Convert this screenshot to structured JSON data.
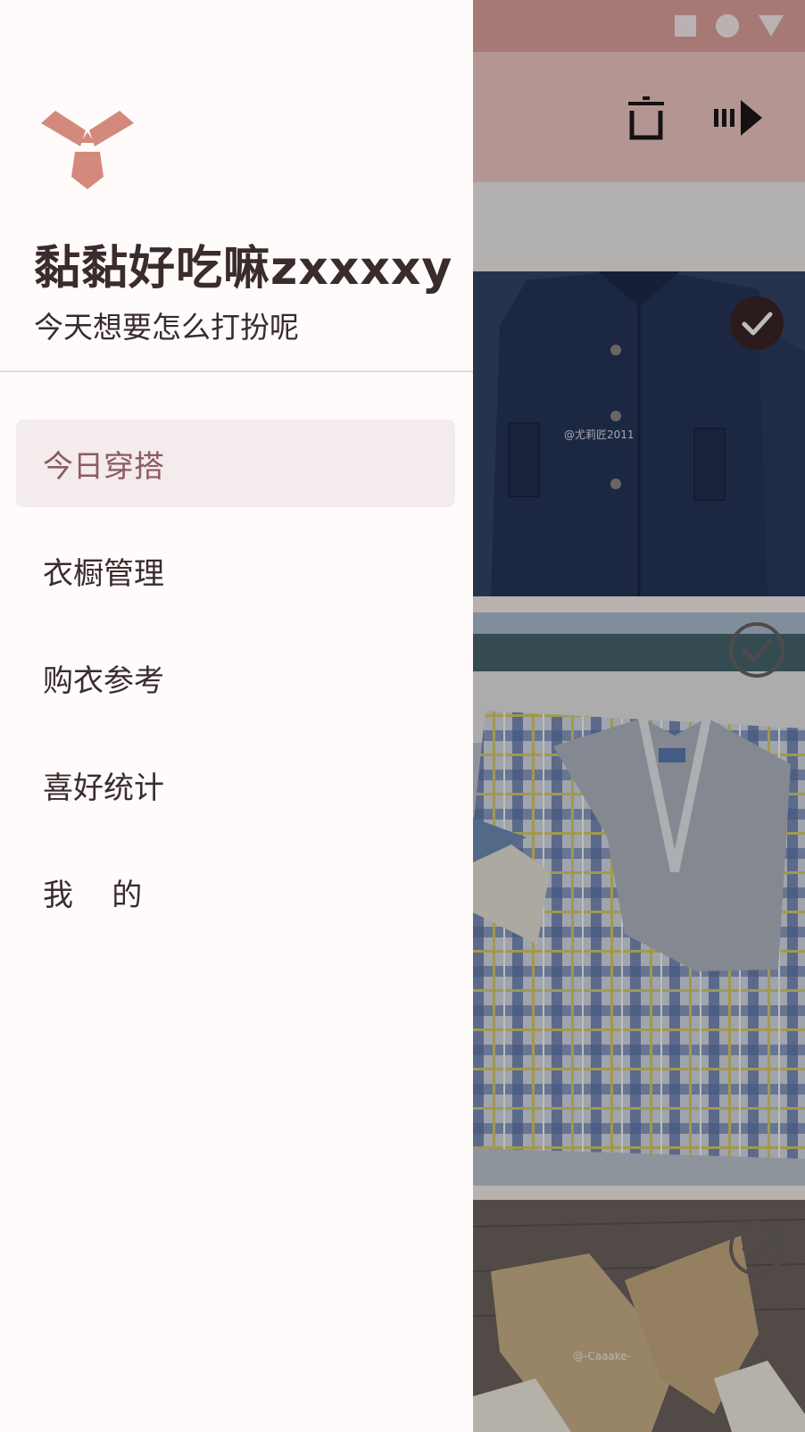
{
  "drawer": {
    "user_name": "黏黏好吃嘛zxxxxy",
    "greeting": "今天想要怎么打扮呢",
    "nav_items": [
      {
        "label": "今日穿搭",
        "active": true
      },
      {
        "label": "衣橱管理",
        "active": false
      },
      {
        "label": "购衣参考",
        "active": false
      },
      {
        "label": "喜好统计",
        "active": false
      },
      {
        "label": "我    的",
        "active": false
      }
    ]
  },
  "background": {
    "app_bar_icons": [
      "delete-icon",
      "next-icon"
    ],
    "cards": [
      {
        "name": "navy-coat",
        "checked": true,
        "watermark": "@尤莉匠2011"
      },
      {
        "name": "plaid-skirt-vest",
        "checked": false,
        "watermark": ""
      },
      {
        "name": "beige-gloves",
        "checked": false,
        "watermark": "@-Caaake-"
      }
    ]
  },
  "colors": {
    "accent": "#d4897d",
    "primary_text": "#3a2b2d",
    "active_item_text": "#8e5a61",
    "active_item_bg": "#f3ebec",
    "status_bar": "#e0a49e",
    "app_bar": "#f2cbc6",
    "drawer_bg": "#fffbfb"
  }
}
